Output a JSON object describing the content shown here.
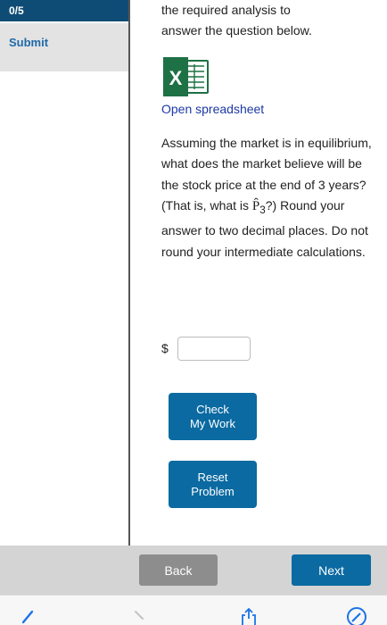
{
  "sidebar": {
    "score": "0/5",
    "submit_label": "Submit"
  },
  "intro": {
    "line1": "the required analysis to",
    "line2": "answer the question below."
  },
  "spreadsheet": {
    "icon": "excel-icon",
    "link_label": "Open spreadsheet"
  },
  "question": {
    "text_before": "Assuming the market is in equilibrium, what does the market believe will be the stock price at the end of 3 years? (That is, what is ",
    "symbol": "P̂",
    "subscript": "3",
    "text_after": "?) Round your answer to two decimal places. Do not round your intermediate calculations."
  },
  "answer": {
    "currency": "$",
    "value": "",
    "placeholder": ""
  },
  "buttons": {
    "check": "Check\nMy Work",
    "reset": "Reset\nProblem"
  },
  "nav": {
    "back": "Back",
    "next": "Next"
  },
  "colors": {
    "primary": "#0a6aa1",
    "score_bar": "#0f4c75",
    "link": "#1d39a6",
    "excel_green": "#1e7145"
  },
  "toolbar": {
    "icons": [
      "back-arrow-icon",
      "forward-arrow-icon",
      "share-icon",
      "compass-icon"
    ]
  }
}
